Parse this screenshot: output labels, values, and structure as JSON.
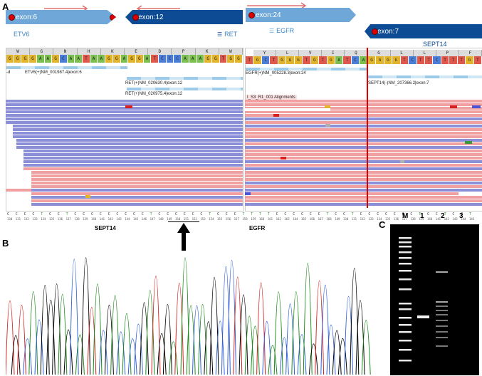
{
  "panels": {
    "a": "A",
    "b": "B",
    "c": "C"
  },
  "exons": {
    "exon6": "exon:6",
    "exon12": "exon:12",
    "exon24": "exon:24",
    "exon7": "exon:7"
  },
  "genes": {
    "etv6": "ETV6",
    "ret": "RET",
    "egfr": "EGFR",
    "sept14": "SEPT14"
  },
  "transcripts": {
    "etv6": "ETV6(+)NM_001987.4|exon:6",
    "ret1": "RET(+)NM_020630.4|exon:12",
    "ret2": "RET(+)NM_020975.4|exon:12",
    "egfr": "EGFR(+)NM_005228.3|exon:24",
    "sept14": "SEPT14(-)NM_207366.2|exon:7",
    "alignments": "I_S3_R1_001 Alignments",
    "left_edge": "-d"
  },
  "aa_left": [
    "W",
    "G",
    "N",
    "H",
    "K",
    "E",
    "D",
    "P",
    "K",
    "W"
  ],
  "aa_right": [
    "Y",
    "L",
    "V",
    "I",
    "Q",
    "G",
    "L",
    "L",
    "P",
    "F"
  ],
  "bases_left": [
    "G",
    "G",
    "G",
    "G",
    "A",
    "A",
    "G",
    "C",
    "A",
    "A",
    "T",
    "A",
    "A",
    "G",
    "G",
    "A",
    "G",
    "G",
    "A",
    "T",
    "C",
    "C",
    "C",
    "A",
    "A",
    "A",
    "G",
    "G",
    "T",
    "G",
    "G"
  ],
  "bases_right": [
    "T",
    "G",
    "C",
    "T",
    "G",
    "G",
    "G",
    "T",
    "G",
    "T",
    "G",
    "A",
    "T",
    "C",
    "A",
    "G",
    "G",
    "G",
    "G",
    "T",
    "C",
    "T",
    "T",
    "C",
    "T",
    "T",
    "T",
    "G",
    "T"
  ],
  "bottom_genes": {
    "left": "SEPT14",
    "right": "EGFR"
  },
  "gel": {
    "lanes": [
      "M",
      "1",
      "2",
      "3"
    ]
  },
  "colors": {
    "read_blue": "#8b8fd8",
    "read_pink": "#f0a0a0",
    "exon_light": "#6fa8d8",
    "exon_dark": "#0d4c94",
    "breakpoint": "#e00000"
  }
}
